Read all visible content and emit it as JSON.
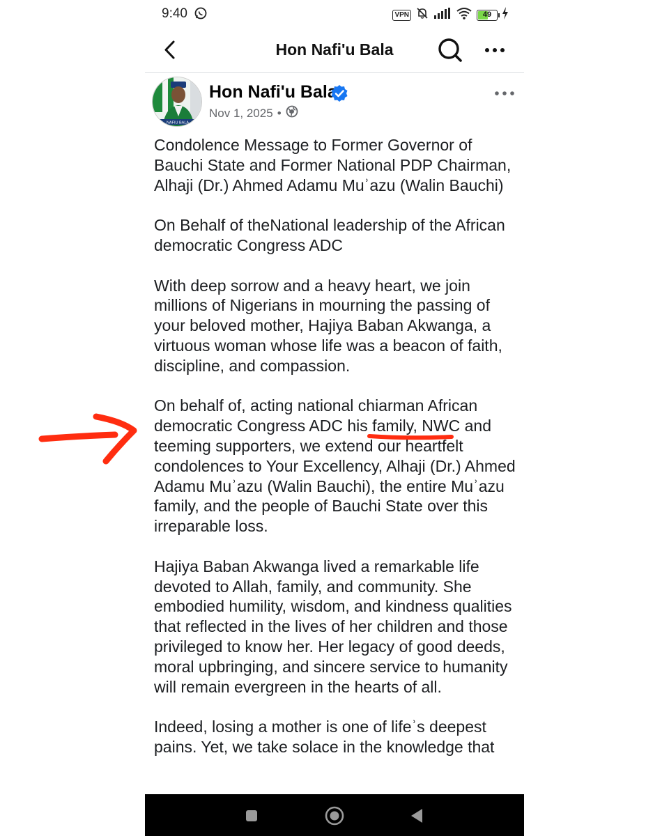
{
  "status_bar": {
    "time": "9:40",
    "vpn_label": "VPN",
    "battery_level": "49",
    "battery_fraction": 0.49,
    "icons": [
      "whatsapp-icon",
      "vpn-icon",
      "mute-icon",
      "signal-icon",
      "wifi-icon",
      "battery-icon",
      "charging-icon"
    ]
  },
  "header": {
    "title": "Hon Nafi'u Bala"
  },
  "post": {
    "author": "Hon Nafi'u Bala",
    "date": "Nov 1, 2025",
    "separator": "•",
    "avatar_caption": "NAFIU BALA",
    "paragraphs": [
      "Condolence Message to Former Governor of Bauchi State and Former National PDP Chairman, Alhaji (Dr.) Ahmed Adamu Muʾazu (Walin Bauchi)",
      "On Behalf of theNational leadership of the African democratic Congress ADC",
      "With deep sorrow and a heavy heart, we join millions of Nigerians in mourning the passing of your beloved mother, Hajiya Baban Akwanga, a virtuous woman whose life was a beacon of faith, discipline, and compassion.",
      "On behalf of,  acting national chiarman African democratic Congress ADC his family, NWC and teeming  supporters, we extend our heartfelt condolences to Your Excellency, Alhaji (Dr.) Ahmed Adamu Muʾazu (Walin Bauchi), the entire Muʾazu family, and the people of Bauchi State over this irreparable loss.",
      "Hajiya Baban Akwanga lived a remarkable life devoted to Allah, family, and community. She embodied humility, wisdom, and kindness qualities that reflected in the lives of her children and those privileged to know her. Her legacy of good deeds, moral upbringing, and sincere service to humanity will remain evergreen in the hearts of all.",
      "Indeed, losing a mother is one of lifeʾs deepest pains. Yet, we take solace in the knowledge that"
    ]
  },
  "colors": {
    "accent_verified": "#1877f2",
    "annotation_red": "#ff2d10",
    "text": "#1c1e21",
    "muted": "#65676b"
  }
}
